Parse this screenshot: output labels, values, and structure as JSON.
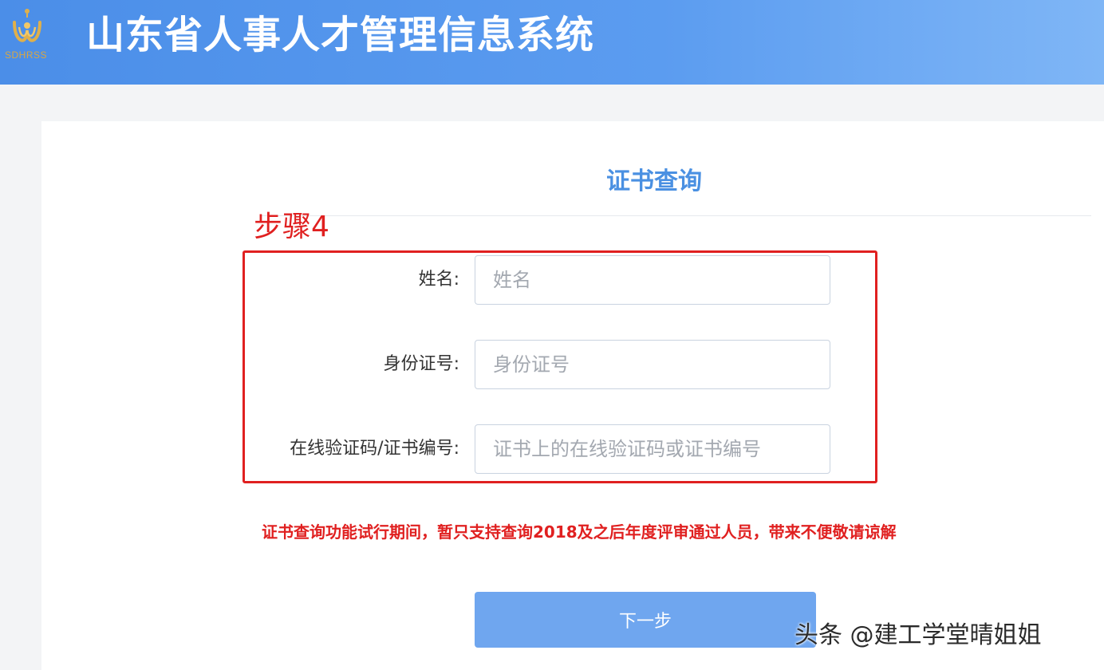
{
  "header": {
    "logo_icon": "emblem-icon",
    "logo_text": "SDHRSS",
    "title": "山东省人事人才管理信息系统"
  },
  "form": {
    "title": "证书查询",
    "annotation": "步骤4",
    "fields": [
      {
        "label": "姓名:",
        "value": "",
        "placeholder": "姓名"
      },
      {
        "label": "身份证号:",
        "value": "",
        "placeholder": "身份证号"
      },
      {
        "label": "在线验证码/证书编号:",
        "value": "",
        "placeholder": "证书上的在线验证码或证书编号"
      }
    ],
    "notice": "证书查询功能试行期间，暂只支持查询2018及之后年度评审通过人员，带来不便敬请谅解",
    "next_button": "下一步"
  },
  "watermark": "头条 @建工学堂晴姐姐",
  "colors": {
    "header_blue": "#5b9cf0",
    "title_blue": "#4a90e2",
    "annotation_red": "#e02020",
    "button_blue": "#6fa6ef"
  }
}
